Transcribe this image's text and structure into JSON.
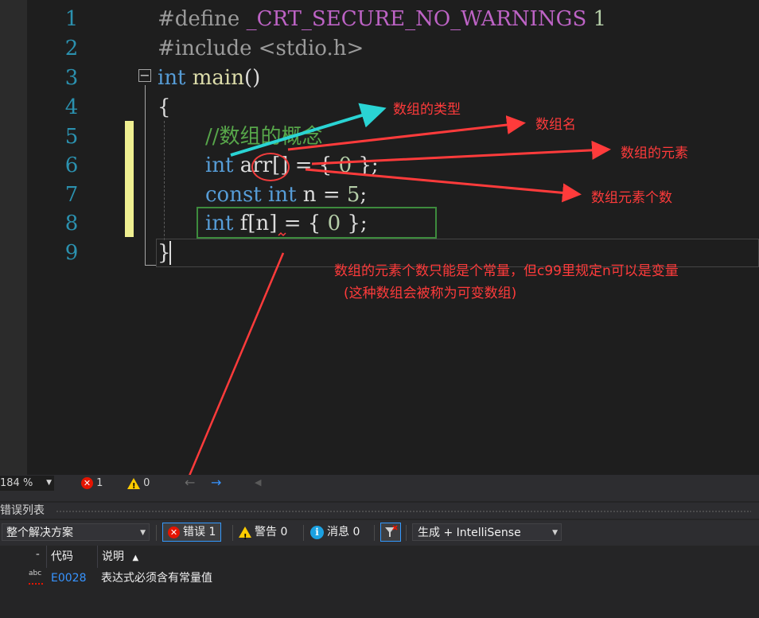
{
  "editor": {
    "line_numbers": [
      "1",
      "2",
      "3",
      "4",
      "5",
      "6",
      "7",
      "8",
      "9"
    ],
    "lines": {
      "l1_directive": "#define",
      "l1_macro": "_CRT_SECURE_NO_WARNINGS",
      "l1_value": "1",
      "l2_directive": "#include",
      "l2_header": "<stdio.h>",
      "l3_type": "int",
      "l3_name": "main",
      "l3_parens": "()",
      "l4_brace": "{",
      "l5_comment": "//数组的概念",
      "l6_type": "int",
      "l6_rest_a": "arr[] = { ",
      "l6_zero": "0",
      "l6_rest_b": " };",
      "l7_const": "const",
      "l7_type": "int",
      "l7_rest": " n = ",
      "l7_five": "5",
      "l7_semi": ";",
      "l8_type": "int",
      "l8_rest_a": " f[n] = { ",
      "l8_zero": "0",
      "l8_rest_b": " };",
      "l9_brace": "}"
    },
    "fold_glyph": "−"
  },
  "annotations": {
    "array_type": "数组的类型",
    "array_name": "数组名",
    "array_elements": "数组的元素",
    "element_count": "数组元素个数",
    "note_line1": "数组的元素个数只能是个常量，但c99里规定n可以是变量",
    "note_line2": "(这种数组会被称为可变数组)"
  },
  "status": {
    "zoom": "184 %",
    "errors": "1",
    "warnings": "0",
    "back_arrow": "←",
    "forward_arrow": "→",
    "scroll_left": "◀"
  },
  "error_list": {
    "title": "错误列表",
    "scope": "整个解决方案",
    "errors_btn": "错误 1",
    "warnings_btn": "警告 0",
    "messages_btn": "消息 0",
    "build_source": "生成 + IntelliSense",
    "col_code": "代码",
    "col_desc": "说明",
    "sort_glyph": "▲",
    "rows": [
      {
        "code": "E0028",
        "description": "表达式必须含有常量值"
      }
    ]
  },
  "colors": {
    "background": "#1e1e1e",
    "keyword": "#569cd6",
    "comment": "#57a64a",
    "number": "#b5cea8",
    "line_number": "#2b91af",
    "annotation_red": "#ff3b3b",
    "arrow_cyan": "#2ad4d4",
    "highlight_green": "#3d8b3d"
  }
}
